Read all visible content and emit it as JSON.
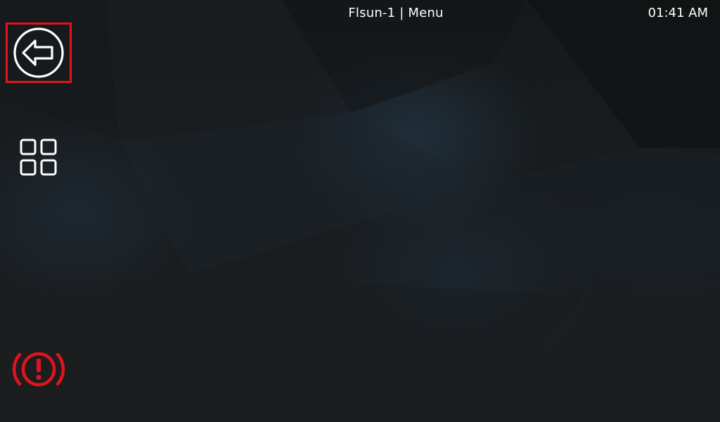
{
  "header": {
    "printer_name": "Flsun-1",
    "separator": "|",
    "panel_title": "Menu",
    "time": "01:41 AM"
  },
  "sidebar": {
    "back_icon": "arrow-left-circle-icon",
    "home_icon": "grid-icon",
    "emergency_icon": "emergency-stop-icon",
    "back_selected": true
  },
  "colors": {
    "background": "#151719",
    "foreground": "#ffffff",
    "selection_outline": "#e0141a",
    "emergency": "#e0141a"
  }
}
